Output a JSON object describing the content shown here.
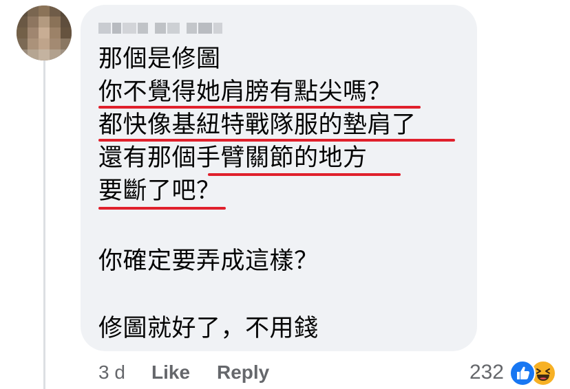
{
  "comment": {
    "author": "",
    "lines": [
      "那個是修圖",
      "你不覺得她肩膀有點尖嗎？",
      "都快像基紐特戰隊服的墊肩了",
      "還有那個手臂關節的地方",
      "要斷了吧？",
      "",
      "你確定要弄成這樣？",
      "",
      "修圖就好了，不用錢"
    ],
    "annotation_color": "#e0202c",
    "bubble_color": "#f0f2f5"
  },
  "meta": {
    "time": "3 d",
    "like_label": "Like",
    "reply_label": "Reply",
    "reaction_count": "232",
    "reactions": [
      "like-icon",
      "haha-icon"
    ]
  },
  "colors": {
    "text": "#050505",
    "secondary": "#65676b",
    "like_blue": "#1877f2",
    "haha_yellow": "#f7b125"
  }
}
